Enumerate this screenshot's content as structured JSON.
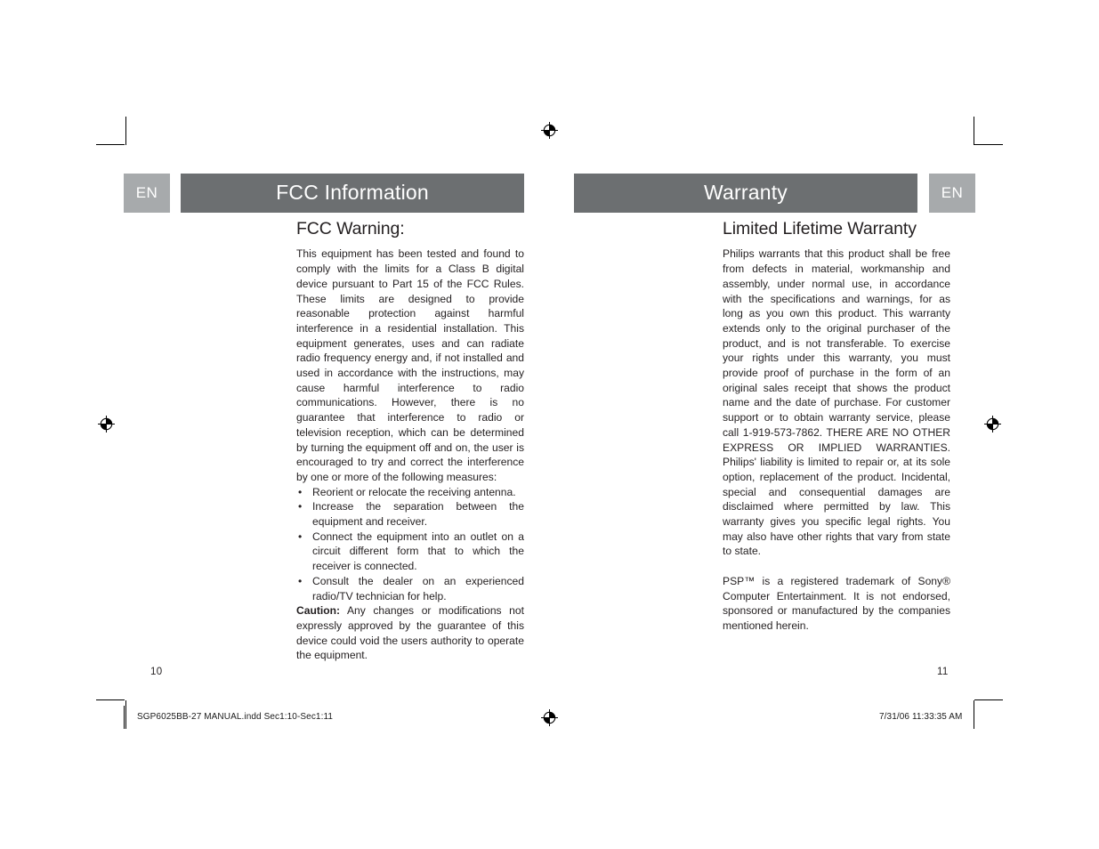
{
  "document": {
    "type": "print-proof-spread",
    "language_badge": "EN",
    "colors": {
      "title_bar": "#6c6f71",
      "lang_badge": "#a7aaac",
      "text": "#231f20",
      "page_background": "#ffffff"
    }
  },
  "left_page": {
    "lang_badge": "EN",
    "header_title": "FCC Information",
    "section_heading": "FCC Warning:",
    "paragraphs": [
      "This equipment has been tested and found to comply with the limits for a Class B digital device pursuant to Part 15 of the FCC Rules. These limits are designed to provide reasonable protection against harmful interference in a residential installation. This equipment generates, uses and can radiate radio frequency energy and, if not installed and used in accordance with the instructions, may cause harmful interference to radio communications. However, there is no guarantee that interference to radio or television reception, which can be determined by turning the equipment off and on, the user is encouraged to try and correct the interference by one or more of the following measures:"
    ],
    "bullets": [
      "Reorient or relocate the receiving antenna.",
      "Increase the separation between the equipment and receiver.",
      "Connect the equipment into an outlet on a circuit different form that to which the receiver is connected.",
      "Consult the dealer on an experienced radio/TV technician for help."
    ],
    "caution_label": "Caution:",
    "caution_text": " Any changes or modifications not expressly approved by the guarantee of this device could void the users authority to operate the equipment.",
    "folio": "10"
  },
  "right_page": {
    "lang_badge": "EN",
    "header_title": "Warranty",
    "section_heading": "Limited Lifetime Warranty",
    "paragraphs": [
      "Philips warrants that this product shall be free from defects in material, workmanship and assembly, under normal use, in accordance with the specifications and warnings, for as long as you own this product. This warranty extends only to the original purchaser of the product, and is not transferable. To exercise your rights under this warranty, you must provide proof of purchase in the form of an original sales receipt that shows the product name and the date of purchase.  For customer support or to obtain warranty service, please call 1-919-573-7862. THERE ARE NO OTHER EXPRESS OR IMPLIED WARRANTIES. Philips' liability is limited to repair or, at its sole option, replacement of the product.  Incidental, special and consequential damages are disclaimed where permitted by law.  This warranty gives you specific legal rights.  You may also have other rights that vary from state to state.",
      "PSP™ is a registered trademark of Sony® Computer Entertainment. It is not endorsed, sponsored or manufactured by the companies mentioned herein."
    ],
    "folio": "11"
  },
  "slug": {
    "filename": "SGP6025BB-27 MANUAL.indd   Sec1:10-Sec1:11",
    "timestamp": "7/31/06   11:33:35 AM"
  }
}
